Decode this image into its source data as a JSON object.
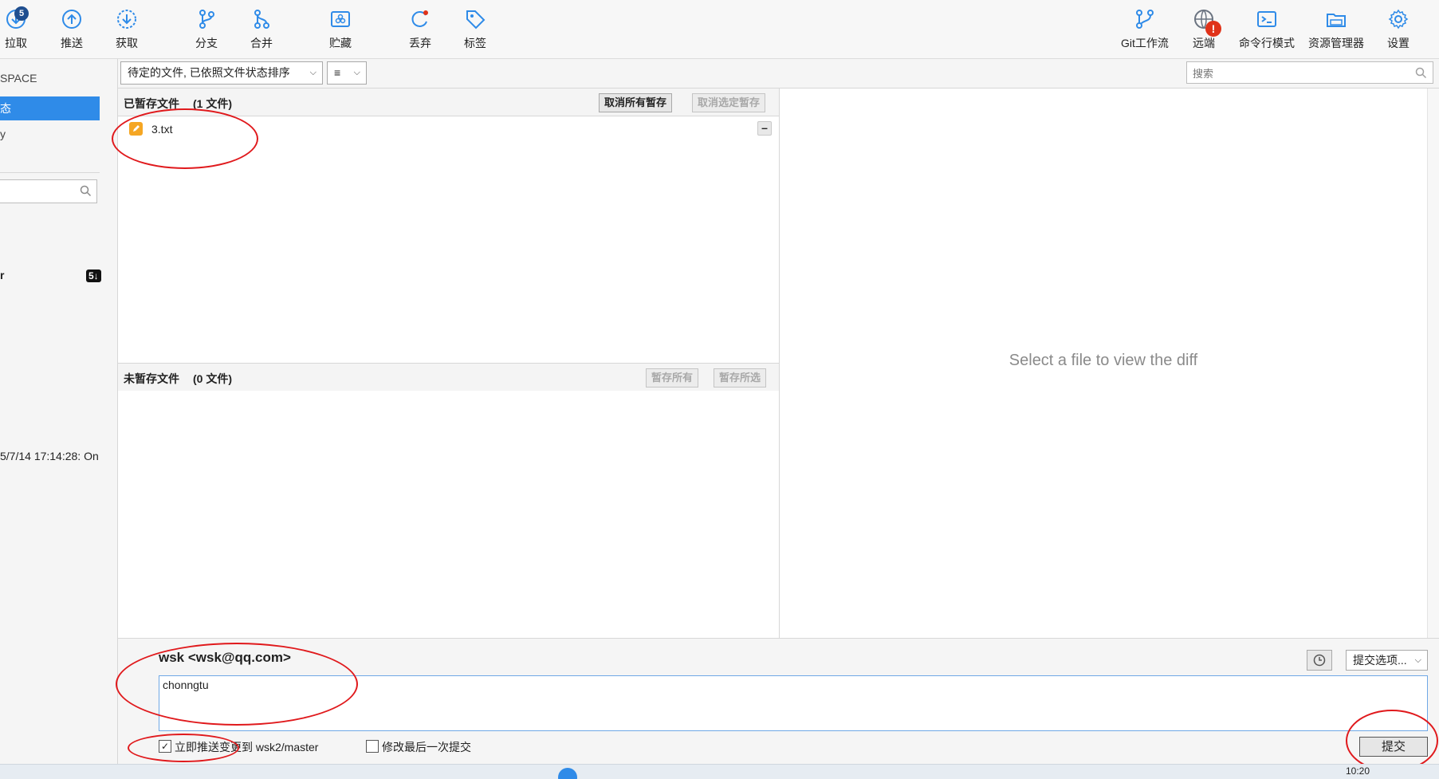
{
  "toolbar": {
    "left": [
      {
        "label": "拉取",
        "icon": "pull-icon",
        "badge": "5"
      },
      {
        "label": "推送",
        "icon": "push-icon"
      },
      {
        "label": "获取",
        "icon": "fetch-icon"
      },
      {
        "label": "分支",
        "icon": "branch-icon"
      },
      {
        "label": "合并",
        "icon": "merge-icon"
      },
      {
        "label": "贮藏",
        "icon": "stash-icon"
      },
      {
        "label": "丢弃",
        "icon": "discard-icon"
      },
      {
        "label": "标签",
        "icon": "tag-icon"
      }
    ],
    "right": [
      {
        "label": "Git工作流",
        "icon": "git-flow-icon"
      },
      {
        "label": "远端",
        "icon": "remote-icon",
        "alert": "!"
      },
      {
        "label": "命令行模式",
        "icon": "terminal-icon"
      },
      {
        "label": "资源管理器",
        "icon": "explorer-icon"
      },
      {
        "label": "设置",
        "icon": "settings-icon"
      }
    ]
  },
  "sidebar": {
    "workspace_header": "SPACE",
    "selected_item": "态",
    "item2": "y",
    "search_placeholder": "",
    "branch_label": "r",
    "branch_badge": "5↓",
    "stash_entry": "5/7/14 17:14:28: On"
  },
  "filter": {
    "view_mode": "待定的文件, 已依照文件状态排序",
    "list_mode_icon": "≡",
    "search_placeholder": "搜索"
  },
  "staged": {
    "title": "已暂存文件",
    "count": "(1 文件)",
    "btn_unstage_all": "取消所有暂存",
    "btn_unstage_selected": "取消选定暂存",
    "files": [
      {
        "name": "3.txt",
        "status": "modified"
      }
    ]
  },
  "unstaged": {
    "title": "未暂存文件",
    "count": "(0 文件)",
    "btn_stage_all": "暂存所有",
    "btn_stage_selected": "暂存所选"
  },
  "diff": {
    "placeholder": "Select a file to view the diff"
  },
  "commit": {
    "author": "wsk <wsk@qq.com>",
    "message": "chonngtu",
    "options_label": "提交选项...",
    "push_checkbox_label": "立即推送变更到 wsk2/master",
    "push_checked": true,
    "amend_label": "修改最后一次提交",
    "amend_checked": false,
    "submit_label": "提交"
  },
  "taskbar": {
    "clock": "10:20"
  },
  "colors": {
    "accent": "#2f8be8",
    "annotation": "#e0191c",
    "badge": "#1f4e8f",
    "alert": "#e03219"
  }
}
